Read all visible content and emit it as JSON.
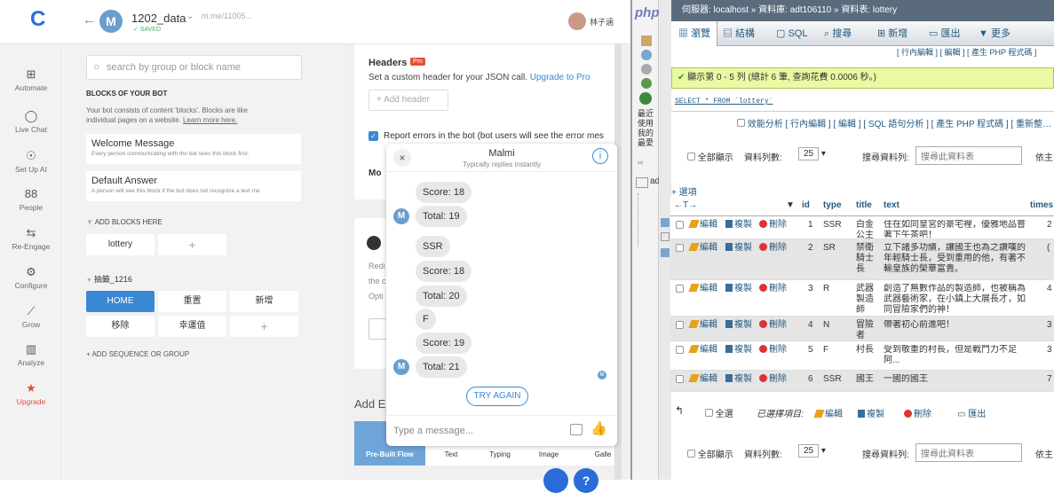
{
  "cf": {
    "logo": "C",
    "back_icon": "arrow-left-icon",
    "bot_avatar": "M",
    "bot_name": "1202_data",
    "bot_dropdown": "v",
    "bot_url": "m.me/11005...",
    "saved": "✓ SAVED",
    "user_name": "林子涵",
    "nav": [
      {
        "label": "Automate",
        "icon": "⊞"
      },
      {
        "label": "Live Chat",
        "icon": "◯"
      },
      {
        "label": "Set Up AI",
        "icon": "☉"
      },
      {
        "label": "People",
        "icon": "88"
      },
      {
        "label": "Re-Engage",
        "icon": "⇆"
      },
      {
        "label": "Configure",
        "icon": "⚙"
      },
      {
        "label": "Grow",
        "icon": "⟋"
      },
      {
        "label": "Analyze",
        "icon": "▥"
      },
      {
        "label": "Upgrade",
        "icon": "★"
      }
    ],
    "search_placeholder": "search by group or block name",
    "blocks_heading": "BLOCKS OF YOUR BOT",
    "blocks_desc_1": "Your bot consists of content 'blocks'. Blocks are like",
    "blocks_desc_2": "individual pages on a website.",
    "learn_more": "Learn more here.",
    "welcome_title": "Welcome Message",
    "welcome_desc": "Every person communicating with the bot sees this block first.",
    "default_title": "Default Answer",
    "default_desc": "A person will see this block if the bot does not recognize a text me",
    "add_blocks": "ADD BLOCKS HERE",
    "lottery_pill": "lottery",
    "plus": "+",
    "group_name": "抽籤_1216",
    "group_pills": [
      "HOME",
      "重置",
      "新增",
      "移除",
      "幸運值"
    ],
    "add_seq": "+ ADD SEQUENCE OR GROUP",
    "headers_title": "Headers",
    "pro_badge": "Pro",
    "headers_desc": "Set a custom header for your JSON call.",
    "upgrade_pro": "Upgrade to Pro",
    "add_header": "+ Add header",
    "report_errors": "Report errors in the bot (bot users will see the error mes",
    "mo_label": "Mo",
    "redi": "Redi",
    "the": "the c",
    "opti": "Opti",
    "add_e": "Add E",
    "flow_tabs": [
      "Pre-Built Flow",
      "Text",
      "Typing",
      "Image",
      "Galle"
    ]
  },
  "chat": {
    "name": "Malmi",
    "status": "Typically replies instantly",
    "avatar": "M",
    "messages": [
      "Score: 18",
      "Total: 19",
      "SSR",
      "Score: 18",
      "Total: 20",
      "F",
      "Score: 19",
      "Total: 21"
    ],
    "try_again": "TRY AGAIN",
    "placeholder": "Type a message..."
  },
  "pma": {
    "logo": "php",
    "sidebar_labels": [
      "最近",
      "使用",
      "我的",
      "最愛"
    ],
    "ad": "ad",
    "breadcrumb": "伺服器: localhost » 資料庫: adt106110 » 資料表: lottery",
    "tabs": [
      "瀏覽",
      "結構",
      "SQL",
      "搜尋",
      "新增",
      "匯出",
      "▼ 更多"
    ],
    "sub_links": "[ 行內編輯 ] [ 編輯 ] [ 產生 PHP 程式碼 ]",
    "result": "顯示第 0 - 5 列 (總計 6 筆, 查詢花費 0.0006 秒。)",
    "query": "SELECT * FROM `lottery`",
    "profile": "效能分析 [ 行內編輯 ] [ 編輯 ] [ SQL 語句分析 ] [ 產生 PHP 程式碼 ] [ 重新整理 ]",
    "show_all": "全部顯示",
    "rows_label": "資料列數:",
    "rows_value": "25",
    "search_label": "搜尋資料列:",
    "search_placeholder": "搜尋此資料表",
    "sort_label": "依主",
    "options": "+ 選項",
    "columns": [
      "id",
      "type",
      "title",
      "text",
      "times"
    ],
    "edit": "編輯",
    "copy": "複製",
    "delete": "刪除",
    "rows": [
      {
        "id": "1",
        "type": "SSR",
        "title": "白金公主",
        "text": "住在如同皇宮的豪宅裡，優雅地品嘗著下午茶吧！",
        "times": "2"
      },
      {
        "id": "2",
        "type": "SR",
        "title": "禁衛騎士長",
        "text": "立下諸多功績，讓國王也為之讚嘆的年輕騎士長，受到重用的他，有著不輸皇族的榮華富貴。",
        "times": "("
      },
      {
        "id": "3",
        "type": "R",
        "title": "武器製造師",
        "text": "創造了無數作品的製造師，也被稱為武器藝術家，在小鎮上大展長才，如同冒險家們的神！",
        "times": "4"
      },
      {
        "id": "4",
        "type": "N",
        "title": "冒險者",
        "text": "帶著初心前進吧！",
        "times": "3"
      },
      {
        "id": "5",
        "type": "F",
        "title": "村長",
        "text": "受到敬重的村長，但是戰鬥力不足阿...",
        "times": "3"
      },
      {
        "id": "6",
        "type": "SSR",
        "title": "國王",
        "text": "一國的國王",
        "times": "7"
      }
    ],
    "check_all": "全選",
    "selected": "已選擇項目:",
    "export": "匯出"
  }
}
